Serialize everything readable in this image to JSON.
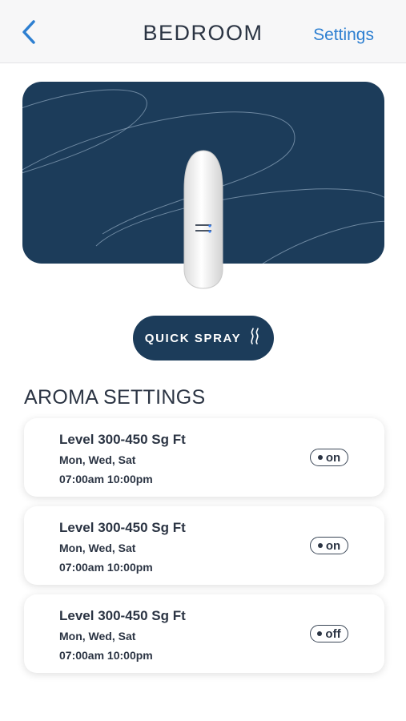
{
  "nav": {
    "back_icon": "chevron-left-icon",
    "title": "BEDROOM",
    "settings_label": "Settings"
  },
  "hero": {
    "background_color": "#1c3c5a",
    "device_icon": "diffuser-device-image"
  },
  "quick_spray": {
    "label": "QUICK SPRAY",
    "icon": "steam-icon"
  },
  "aroma": {
    "title": "AROMA SETTINGS",
    "schedules": [
      {
        "level": "Level 300-450 Sg Ft",
        "days": "Mon, Wed, Sat",
        "times": "07:00am 10:00pm",
        "status": "on"
      },
      {
        "level": "Level 300-450 Sg Ft",
        "days": "Mon, Wed, Sat",
        "times": "07:00am 10:00pm",
        "status": "on"
      },
      {
        "level": "Level 300-450 Sg Ft",
        "days": "Mon, Wed, Sat",
        "times": "07:00am 10:00pm",
        "status": "off"
      }
    ]
  },
  "colors": {
    "accent": "#2d7fd1",
    "brand_navy": "#1c3c5a"
  }
}
